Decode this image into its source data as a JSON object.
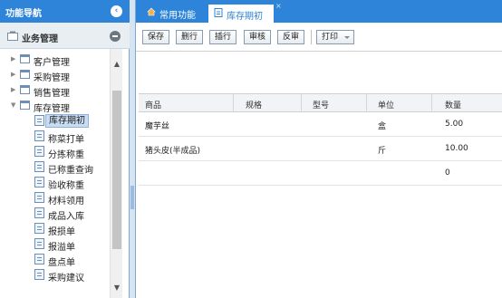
{
  "nav": {
    "title": "功能导航",
    "group_label": "业务管理",
    "tree": [
      {
        "label": "客户管理",
        "kind": "folder",
        "expanded": false
      },
      {
        "label": "采购管理",
        "kind": "folder",
        "expanded": false
      },
      {
        "label": "销售管理",
        "kind": "folder",
        "expanded": false
      },
      {
        "label": "库存管理",
        "kind": "folder",
        "expanded": true
      },
      {
        "label": "库存期初",
        "kind": "doc",
        "selected": true
      },
      {
        "label": "称菜打单",
        "kind": "doc"
      },
      {
        "label": "分拣称重",
        "kind": "doc"
      },
      {
        "label": "已称重查询",
        "kind": "doc"
      },
      {
        "label": "验收称重",
        "kind": "doc"
      },
      {
        "label": "材料领用",
        "kind": "doc"
      },
      {
        "label": "成品入库",
        "kind": "doc"
      },
      {
        "label": "报损单",
        "kind": "doc"
      },
      {
        "label": "报溢单",
        "kind": "doc"
      },
      {
        "label": "盘点单",
        "kind": "doc"
      },
      {
        "label": "采购建议",
        "kind": "doc"
      }
    ]
  },
  "tabs": {
    "home_label": "常用功能",
    "active_label": "库存期初",
    "close_glyph": "×"
  },
  "toolbar": {
    "save": "保存",
    "delete_row": "删行",
    "add_row": "插行",
    "approve": "审核",
    "unapprove": "反审",
    "print": "打印"
  },
  "table": {
    "columns": [
      "商品",
      "规格",
      "型号",
      "单位",
      "数量"
    ],
    "rows": [
      [
        "魔芋丝",
        "",
        "",
        "盒",
        "5.00"
      ],
      [
        "猪头皮(半成品)",
        "",
        "",
        "斤",
        "10.00"
      ],
      [
        "",
        "",
        "",
        "",
        "0"
      ]
    ]
  },
  "colors": {
    "header_blue": "#2d84d8",
    "selected_item_bg": "#c8dcf3"
  }
}
